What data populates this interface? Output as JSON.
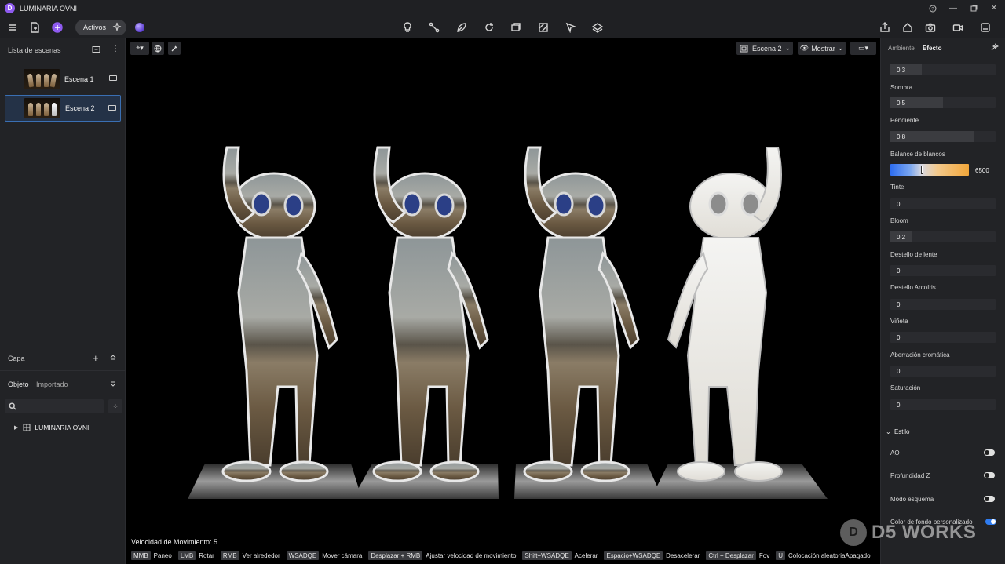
{
  "app": {
    "title": "LUMINARIA OVNI",
    "logo_icon": "d5-logo-icon"
  },
  "toolbar": {
    "assets_label": "Activos",
    "center_tools": [
      "lightbulb-icon",
      "path-icon",
      "leaf-icon",
      "refresh-icon",
      "crop-icon",
      "texture-icon",
      "cursor-pen-icon",
      "layers-icon"
    ],
    "right_tools": [
      "export-icon",
      "house-icon",
      "camera-icon",
      "video-icon",
      "render-box-icon"
    ]
  },
  "left_panel": {
    "scene_list_title": "Lista de escenas",
    "scenes": [
      {
        "label": "Escena 1",
        "active": false
      },
      {
        "label": "Escena 2",
        "active": true
      }
    ],
    "layer_title": "Capa",
    "tabs": [
      "Objeto",
      "Importado"
    ],
    "tree_root": "LUMINARIA OVNI"
  },
  "viewport": {
    "scene_selector": "Escena 2",
    "show_label": "Mostrar",
    "speed_label": "Velocidad de Movimiento: 5",
    "shortcuts": [
      {
        "key": "MMB",
        "desc": "Paneo"
      },
      {
        "key": "LMB",
        "desc": "Rotar"
      },
      {
        "key": "RMB",
        "desc": "Ver alrededor"
      },
      {
        "key": "WSADQE",
        "desc": "Mover cámara"
      },
      {
        "key": "Desplazar + RMB",
        "desc": "Ajustar velocidad de movimiento"
      },
      {
        "key": "Shift+WSADQE",
        "desc": "Acelerar"
      },
      {
        "key": "Espacio+WSADQE",
        "desc": "Desacelerar"
      },
      {
        "key": "Ctrl + Desplazar",
        "desc": "Fov"
      },
      {
        "key": "U",
        "desc": "Colocación aleatoriaApagado"
      }
    ]
  },
  "right_panel": {
    "tabs": [
      "Ambiente",
      "Efecto"
    ],
    "active_tab": "Efecto",
    "top_value": {
      "value": "0.3",
      "fraction": 0.3
    },
    "properties": [
      {
        "label": "Sombra",
        "value": "0.5",
        "fraction": 0.5
      },
      {
        "label": "Pendiente",
        "value": "0.8",
        "fraction": 0.8
      }
    ],
    "white_balance": {
      "label": "Balance de blancos",
      "value": "6500",
      "fraction": 0.39
    },
    "properties2": [
      {
        "label": "Tinte",
        "value": "0",
        "fraction": 0
      },
      {
        "label": "Bloom",
        "value": "0.2",
        "fraction": 0.2
      },
      {
        "label": "Destello de lente",
        "value": "0",
        "fraction": 0
      },
      {
        "label": "Destello Arcoíris",
        "value": "0",
        "fraction": 0
      },
      {
        "label": "Viñeta",
        "value": "0",
        "fraction": 0
      },
      {
        "label": "Aberración cromática",
        "value": "0",
        "fraction": 0
      },
      {
        "label": "Saturación",
        "value": "0",
        "fraction": 0
      }
    ],
    "style_section": "Estilo",
    "toggles": [
      {
        "label": "AO",
        "on": false
      },
      {
        "label": "Profundidad Z",
        "on": false
      },
      {
        "label": "Modo esquema",
        "on": false
      },
      {
        "label": "Color de fondo personalizado",
        "on": true
      }
    ]
  },
  "watermark": {
    "text": "D5 WORKS"
  },
  "colors": {
    "accent": "#3a6fb3",
    "toggle_on": "#2f7cf0",
    "brand_purple": "#8f5bf0"
  }
}
